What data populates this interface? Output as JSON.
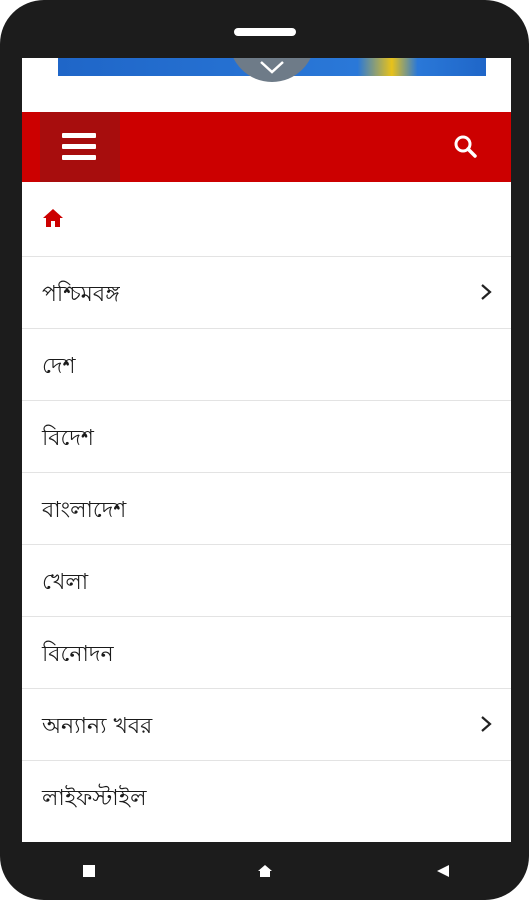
{
  "menu": {
    "items": [
      {
        "label": "পশ্চিমবঙ্গ",
        "has_submenu": true
      },
      {
        "label": "দেশ",
        "has_submenu": false
      },
      {
        "label": "বিদেশ",
        "has_submenu": false
      },
      {
        "label": "বাংলাদেশ",
        "has_submenu": false
      },
      {
        "label": "খেলা",
        "has_submenu": false
      },
      {
        "label": "বিনোদন",
        "has_submenu": false
      },
      {
        "label": "অন্যান্য খবর",
        "has_submenu": true
      },
      {
        "label": "লাইফস্টাইল",
        "has_submenu": false
      }
    ]
  },
  "icons": {
    "menu": "hamburger-icon",
    "search": "search-icon",
    "home": "home-icon",
    "submenu": "chevron-right-icon",
    "banner_toggle": "chevron-down-icon",
    "nav_recent": "square-icon",
    "nav_home": "home-icon",
    "nav_back": "triangle-left-icon"
  },
  "colors": {
    "header": "#cc0000",
    "menu_button": "#a70d0d",
    "home_icon": "#cc0000",
    "divider": "#e3e3e3",
    "phone_frame": "#1c1c1c"
  }
}
